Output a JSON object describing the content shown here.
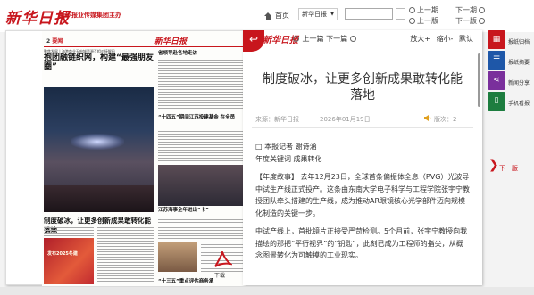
{
  "header": {
    "logo": "新华日报",
    "logo_sub": "新华报业传媒集团主办",
    "home_label": "首页",
    "edition_select": "新华日报",
    "search_placeholder": "",
    "prev_issue": "上一期",
    "next_issue": "下一期",
    "prev_page": "上一版",
    "next_page": "下一版"
  },
  "paper": {
    "page_no": "2",
    "section": "要闻",
    "masthead": "新华日报",
    "kicker": "聚焦发展 | 海港商业天府城资源互相对接解码",
    "headline1": "抱团融链织网，构建“最强朋友圈”",
    "headline2": "制度破冰，让更多创新成果敢转化能落地",
    "photo2_label": "发布2025冬建",
    "right_heads": [
      "省领导赴各地走访",
      "“十四五”期间江苏投建基金 在全员",
      "江苏海事全年进出“卡”",
      "“十三五”重点评估商务承"
    ],
    "pdf_label": "下载"
  },
  "article": {
    "logo": "新华日报",
    "prev_article": "上一篇",
    "next_article": "下一篇",
    "zoom_in": "放大+",
    "zoom_out": "缩小-",
    "close": "默认",
    "title": "制度破冰，让更多创新成果敢转化能落地",
    "source": "来源：新华日报",
    "date": "2026年01月19日",
    "version": "版次：2",
    "author": "□ 本报记者 谢诗涵",
    "keywords": "年度关键词 成果转化",
    "para1": "【年度故事】 去年12月23日，全球首条偏振体全息（PVG）光波导中试生产线正式投产。这条由东南大学电子科学与工程学院张宇宁教授团队牵头搭建的生产线，成为推动AR眼镜核心光学部件迈向规模化制造的关键一步。",
    "para2": "中试产线上，首批镜片正接受严苛检测。5个月前，张宇宁教授向我描绘的那把“平行视界”的“钥匙”，此刻已成为工程师的指尖，从概念图景转化为可触摸的工业现实。"
  },
  "sidebar": {
    "items": [
      {
        "label": "报纸归档",
        "icon": "calendar-icon",
        "color": "#c8161d"
      },
      {
        "label": "报纸摘要",
        "icon": "list-icon",
        "color": "#1e57a8"
      },
      {
        "label": "新闻分享",
        "icon": "share-icon",
        "color": "#7a2f9c"
      },
      {
        "label": "手机看报",
        "icon": "phone-icon",
        "color": "#1d7d3f"
      }
    ],
    "next_label": "下一版"
  },
  "colors": {
    "brand": "#c8161d"
  }
}
